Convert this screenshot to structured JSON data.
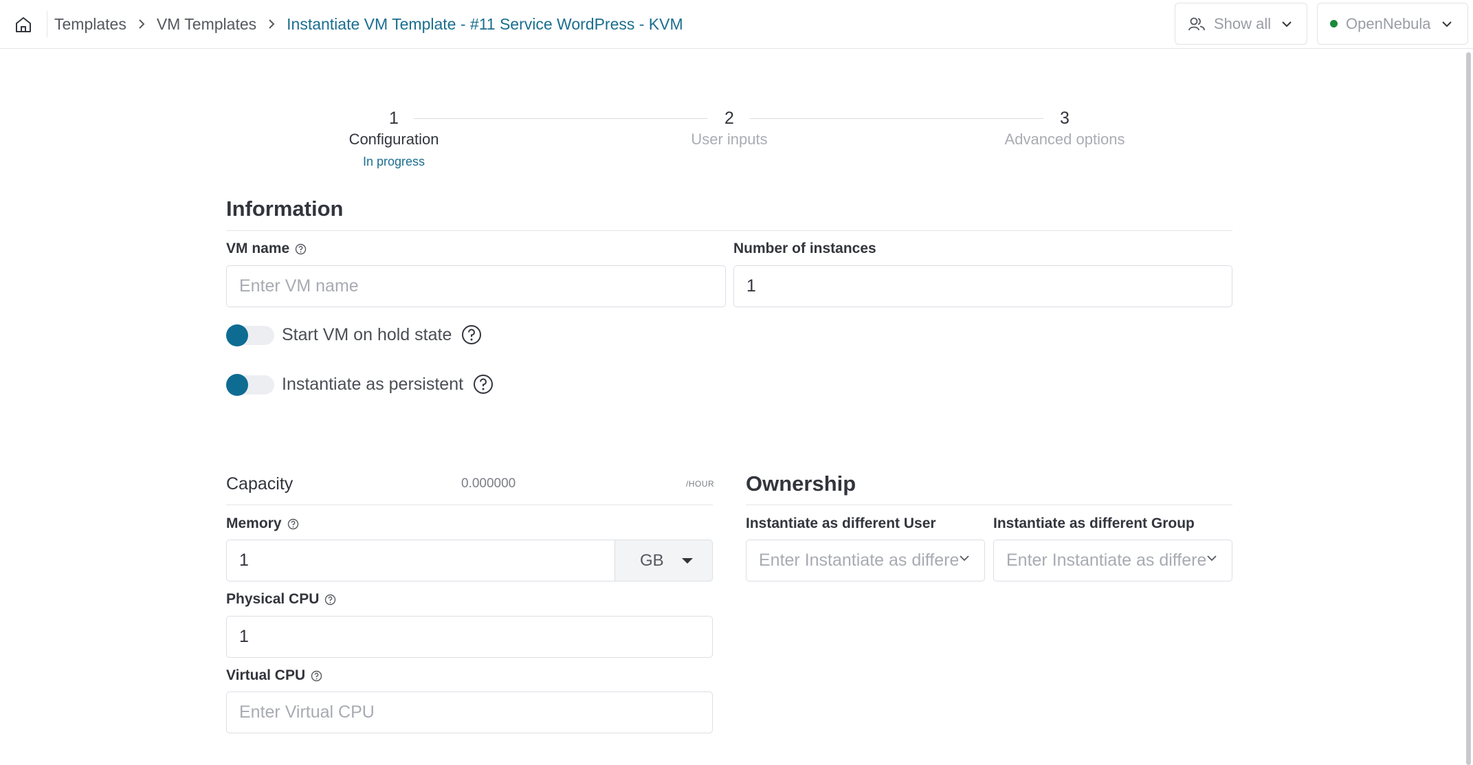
{
  "breadcrumb": {
    "items": [
      "Templates",
      "VM Templates"
    ],
    "current": "Instantiate VM Template - #11 Service WordPress - KVM"
  },
  "header": {
    "filter_label": "Show all",
    "zone_label": "OpenNebula",
    "zone_status_color": "#1a8a3a"
  },
  "stepper": {
    "steps": [
      {
        "number": "1",
        "title": "Configuration",
        "status": "In progress"
      },
      {
        "number": "2",
        "title": "User inputs"
      },
      {
        "number": "3",
        "title": "Advanced options"
      }
    ]
  },
  "information": {
    "heading": "Information",
    "vm_name_label": "VM name",
    "vm_name_placeholder": "Enter VM name",
    "vm_name_value": "",
    "instances_label": "Number of instances",
    "instances_value": "1",
    "hold_label": "Start VM on hold state",
    "persistent_label": "Instantiate as persistent"
  },
  "capacity": {
    "heading": "Capacity",
    "cost": "0.000000",
    "cost_unit": "/HOUR",
    "memory_label": "Memory",
    "memory_value": "1",
    "memory_unit": "GB",
    "pcpu_label": "Physical CPU",
    "pcpu_value": "1",
    "vcpu_label": "Virtual CPU",
    "vcpu_placeholder": "Enter Virtual CPU"
  },
  "ownership": {
    "heading": "Ownership",
    "user_label": "Instantiate as different User",
    "user_placeholder": "Enter Instantiate as different User",
    "group_label": "Instantiate as different Group",
    "group_placeholder": "Enter Instantiate as different Group"
  },
  "colors": {
    "accent": "#0e6c93",
    "link": "#1b6e8f"
  }
}
